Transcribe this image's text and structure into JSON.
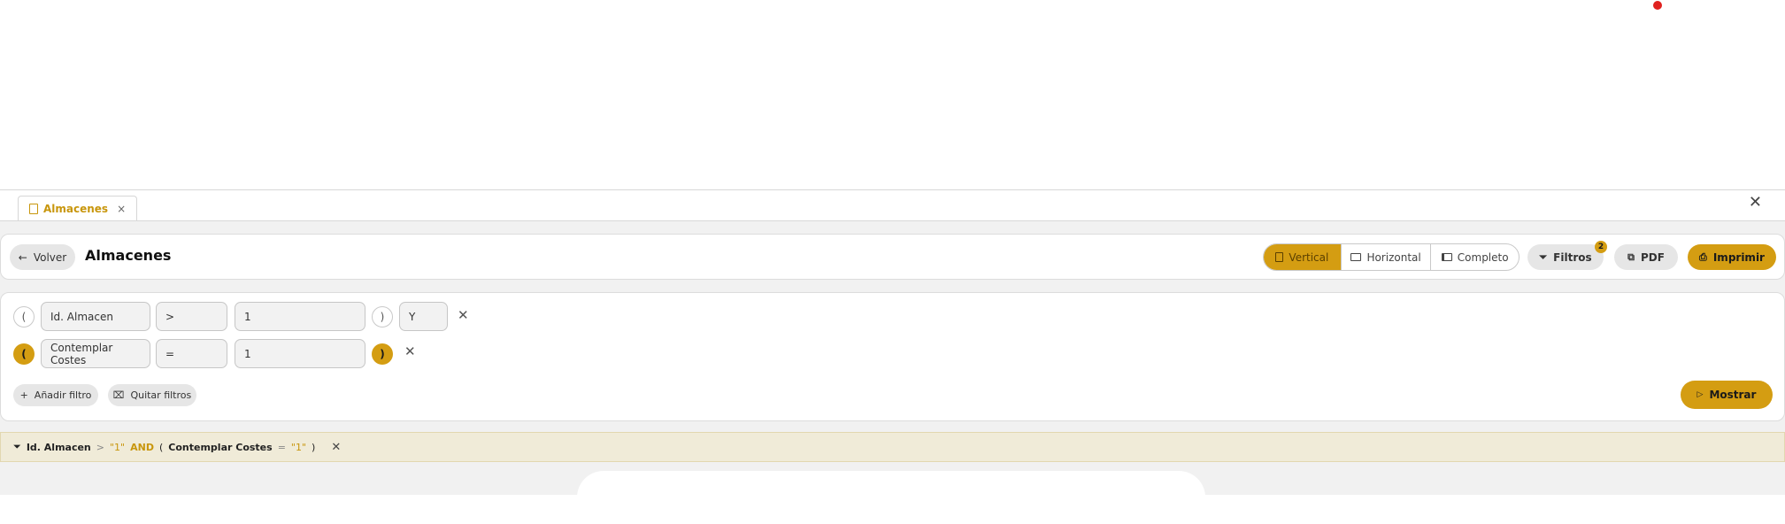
{
  "tabbar": {
    "tab_label": "Almacenes",
    "tab_close": "×",
    "close_icon": "✕"
  },
  "header": {
    "back_label": "Volver",
    "back_icon": "←",
    "title": "Almacenes",
    "views": [
      "Vertical",
      "Horizontal",
      "Completo"
    ],
    "active_view": "Vertical",
    "filters_label": "Filtros",
    "filters_count": "2",
    "pdf_label": "PDF",
    "print_label": "Imprimir"
  },
  "filters": {
    "rows": [
      {
        "open": "(",
        "field": "Id. Almacen",
        "operator": ">",
        "value": "1",
        "close": ")",
        "connector": "Y",
        "remove": "✕"
      },
      {
        "open": "(",
        "field": "Contemplar Costes",
        "operator": "=",
        "value": "1",
        "close": ")",
        "remove": "✕"
      }
    ],
    "add_label": "Añadir filtro",
    "clear_label": "Quitar filtros",
    "show_label": "Mostrar"
  },
  "summary": {
    "field1": "Id. Almacen",
    "op1": ">",
    "val1": "\"1\"",
    "and": "AND",
    "open": "(",
    "field2": "Contemplar Costes",
    "op2": "=",
    "val2": "\"1\"",
    "close": ")",
    "remove": "✕"
  },
  "colors": {
    "accent": "#d49d12",
    "status_dot": "#e0211f"
  }
}
